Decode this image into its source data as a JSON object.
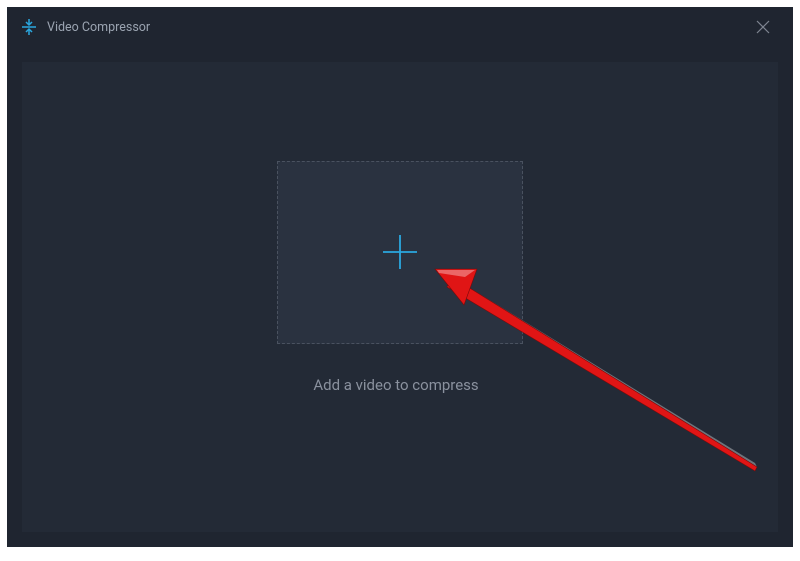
{
  "header": {
    "title": "Video Compressor"
  },
  "main": {
    "instruction": "Add a video to compress"
  },
  "colors": {
    "accent": "#2aa8e0",
    "arrow": "#e01515"
  }
}
